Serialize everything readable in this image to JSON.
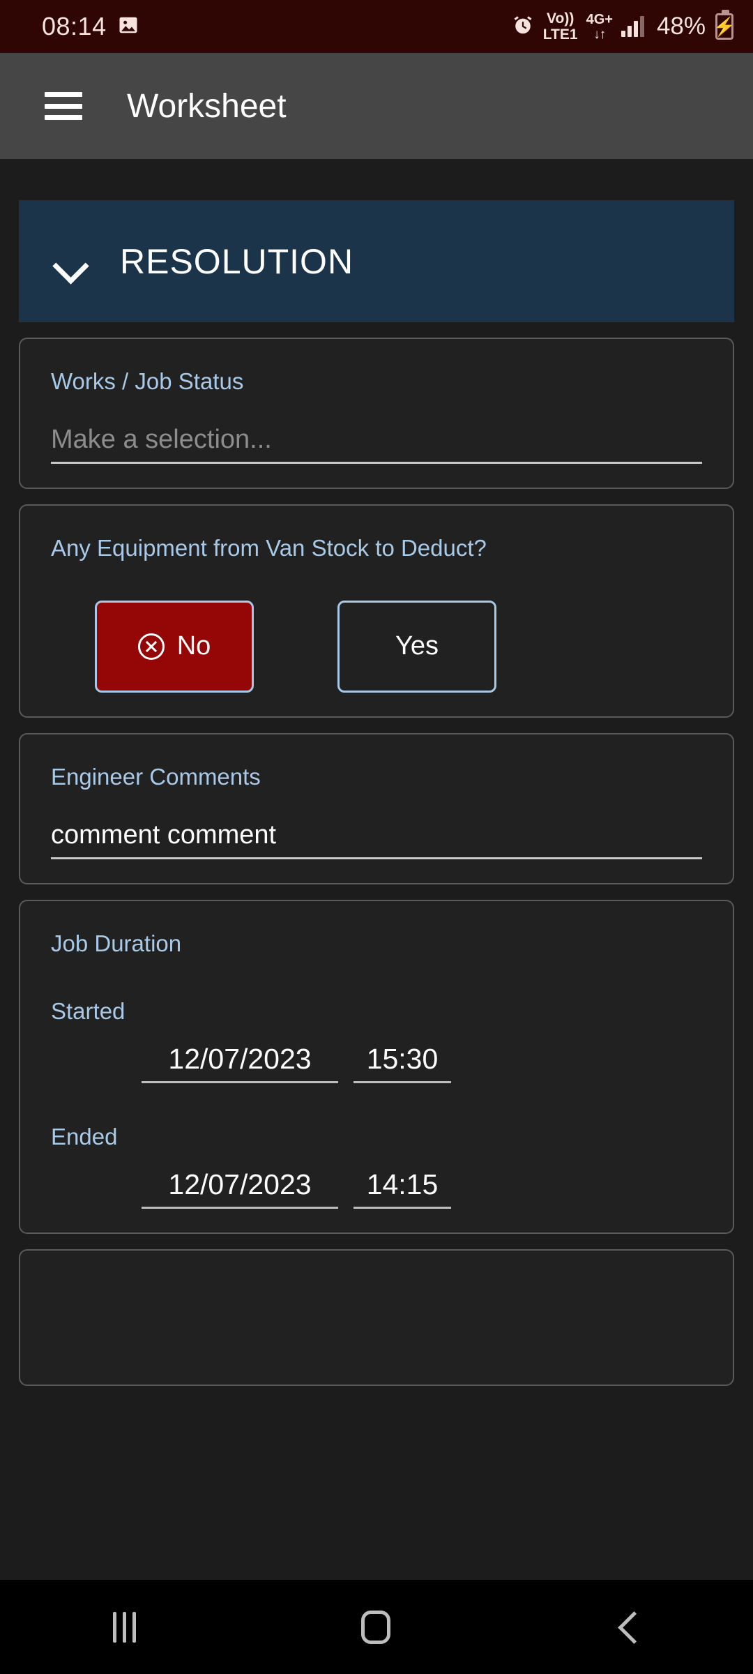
{
  "status_bar": {
    "time": "08:14",
    "photo_icon": "image-icon",
    "alarm_icon": "alarm-clock-icon",
    "volte_line1": "Vo))",
    "volte_line2": "LTE1",
    "network_type": "4G+",
    "network_arrows": "↓↑",
    "signal_icon": "signal-bars-icon",
    "battery_percent": "48%",
    "battery_icon": "battery-charging-icon",
    "background_color": "#300604"
  },
  "app_bar": {
    "menu_icon": "hamburger-menu-icon",
    "title": "Worksheet",
    "background_color": "#464646"
  },
  "section": {
    "title": "RESOLUTION",
    "expand_icon": "chevron-down-icon",
    "background_color": "#1c3449",
    "expanded": true
  },
  "fields": {
    "job_status": {
      "label": "Works / Job Status",
      "value": "",
      "placeholder": "Make a selection..."
    },
    "van_stock": {
      "label": "Any Equipment from Van Stock to Deduct?",
      "options": [
        {
          "label": "No",
          "icon": "x-circle-icon",
          "selected": true
        },
        {
          "label": "Yes",
          "icon": "",
          "selected": false
        }
      ],
      "selected_color": "#950606",
      "border_color": "#a8c8e8"
    },
    "engineer_comments": {
      "label": "Engineer Comments",
      "value": "comment comment"
    },
    "job_duration": {
      "label": "Job Duration",
      "started_label": "Started",
      "started_date": "12/07/2023",
      "started_time": "15:30",
      "ended_label": "Ended",
      "ended_date": "12/07/2023",
      "ended_time": "14:15"
    }
  },
  "nav_bar": {
    "recents_icon": "recents-icon",
    "home_icon": "home-icon",
    "back_icon": "back-icon"
  },
  "theme": {
    "page_background": "#1c1c1c",
    "card_background": "#212121",
    "card_border": "#5a5a5a",
    "label_blue": "#a9c9e8",
    "text_white": "#ffffff",
    "placeholder_gray": "#8d8d8d"
  }
}
